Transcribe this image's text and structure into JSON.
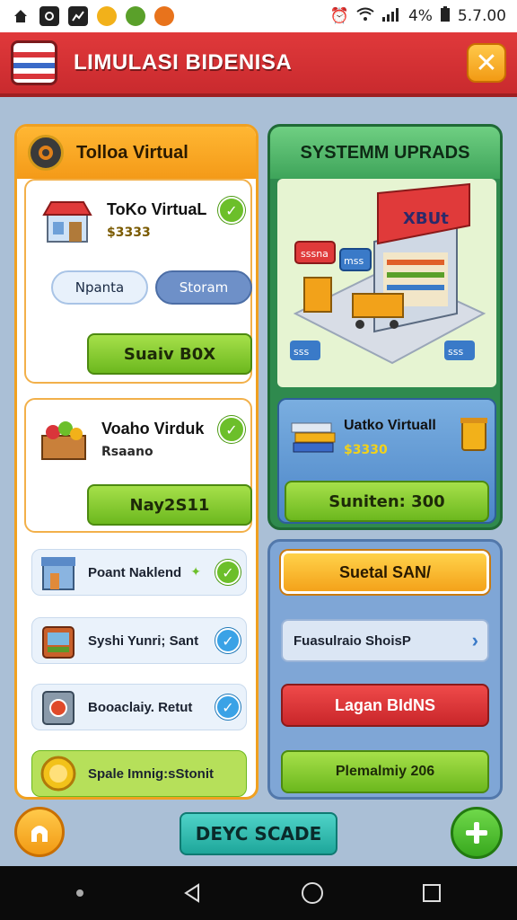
{
  "status_bar": {
    "battery": "4%",
    "time": "5.7.00"
  },
  "header": {
    "title": "LIMULASI BIDENISA",
    "close_label": "✕"
  },
  "left_panel": {
    "title": "Tolloa Virtual",
    "card1": {
      "title": "ToKo VirtuaL",
      "sub": "$3333",
      "tab_left": "Npanta",
      "tab_right": "Storam",
      "button": "Suaiv B0X"
    },
    "card2": {
      "title": "Voaho Virduk",
      "sub": "Rsaano",
      "button": "Nay2S11"
    },
    "rows": [
      {
        "label": "Poant Naklend"
      },
      {
        "label": "Syshi Yunri; Sant"
      },
      {
        "label": "Booaclaiy. Retut"
      },
      {
        "label": "Spale Imnig:sStonit"
      }
    ]
  },
  "right_panel": {
    "title": "SYSTEMM UPRADS",
    "illustration": {
      "sign": "XBUt",
      "tag1": "sssna",
      "tag2": "mss",
      "tag3": "sss",
      "tag4": "sss"
    },
    "info_card": {
      "title": "Uatko Virtuall",
      "sub": "$3330",
      "button": "Suniten: 300"
    },
    "buttons": {
      "orange": "Suetal SAN/",
      "light": "Fuasulraio ShoisP",
      "red": "Lagan BIdNS",
      "green": "Plemalmiy 206"
    }
  },
  "bottom": {
    "deck_label": "DEYC SCADE"
  },
  "colors": {
    "header_red": "#d9353a",
    "accent_orange": "#f5a21c",
    "green": "#6cb81e",
    "blue": "#4c86c8"
  }
}
